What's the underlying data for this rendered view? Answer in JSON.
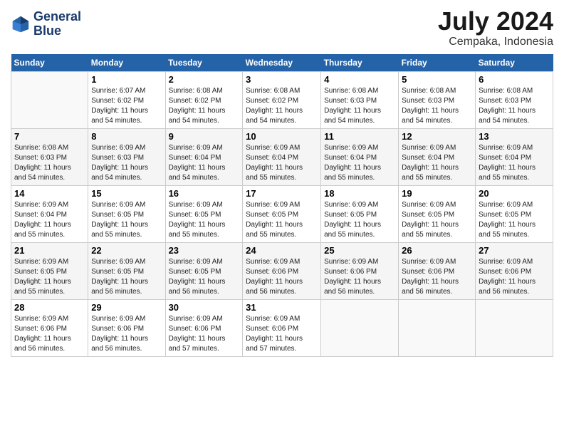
{
  "header": {
    "logo_line1": "General",
    "logo_line2": "Blue",
    "month": "July 2024",
    "location": "Cempaka, Indonesia"
  },
  "days_of_week": [
    "Sunday",
    "Monday",
    "Tuesday",
    "Wednesday",
    "Thursday",
    "Friday",
    "Saturday"
  ],
  "weeks": [
    [
      {
        "day": "",
        "info": ""
      },
      {
        "day": "1",
        "info": "Sunrise: 6:07 AM\nSunset: 6:02 PM\nDaylight: 11 hours\nand 54 minutes."
      },
      {
        "day": "2",
        "info": "Sunrise: 6:08 AM\nSunset: 6:02 PM\nDaylight: 11 hours\nand 54 minutes."
      },
      {
        "day": "3",
        "info": "Sunrise: 6:08 AM\nSunset: 6:02 PM\nDaylight: 11 hours\nand 54 minutes."
      },
      {
        "day": "4",
        "info": "Sunrise: 6:08 AM\nSunset: 6:03 PM\nDaylight: 11 hours\nand 54 minutes."
      },
      {
        "day": "5",
        "info": "Sunrise: 6:08 AM\nSunset: 6:03 PM\nDaylight: 11 hours\nand 54 minutes."
      },
      {
        "day": "6",
        "info": "Sunrise: 6:08 AM\nSunset: 6:03 PM\nDaylight: 11 hours\nand 54 minutes."
      }
    ],
    [
      {
        "day": "7",
        "info": "Sunrise: 6:08 AM\nSunset: 6:03 PM\nDaylight: 11 hours\nand 54 minutes."
      },
      {
        "day": "8",
        "info": "Sunrise: 6:09 AM\nSunset: 6:03 PM\nDaylight: 11 hours\nand 54 minutes."
      },
      {
        "day": "9",
        "info": "Sunrise: 6:09 AM\nSunset: 6:04 PM\nDaylight: 11 hours\nand 54 minutes."
      },
      {
        "day": "10",
        "info": "Sunrise: 6:09 AM\nSunset: 6:04 PM\nDaylight: 11 hours\nand 55 minutes."
      },
      {
        "day": "11",
        "info": "Sunrise: 6:09 AM\nSunset: 6:04 PM\nDaylight: 11 hours\nand 55 minutes."
      },
      {
        "day": "12",
        "info": "Sunrise: 6:09 AM\nSunset: 6:04 PM\nDaylight: 11 hours\nand 55 minutes."
      },
      {
        "day": "13",
        "info": "Sunrise: 6:09 AM\nSunset: 6:04 PM\nDaylight: 11 hours\nand 55 minutes."
      }
    ],
    [
      {
        "day": "14",
        "info": "Sunrise: 6:09 AM\nSunset: 6:04 PM\nDaylight: 11 hours\nand 55 minutes."
      },
      {
        "day": "15",
        "info": "Sunrise: 6:09 AM\nSunset: 6:05 PM\nDaylight: 11 hours\nand 55 minutes."
      },
      {
        "day": "16",
        "info": "Sunrise: 6:09 AM\nSunset: 6:05 PM\nDaylight: 11 hours\nand 55 minutes."
      },
      {
        "day": "17",
        "info": "Sunrise: 6:09 AM\nSunset: 6:05 PM\nDaylight: 11 hours\nand 55 minutes."
      },
      {
        "day": "18",
        "info": "Sunrise: 6:09 AM\nSunset: 6:05 PM\nDaylight: 11 hours\nand 55 minutes."
      },
      {
        "day": "19",
        "info": "Sunrise: 6:09 AM\nSunset: 6:05 PM\nDaylight: 11 hours\nand 55 minutes."
      },
      {
        "day": "20",
        "info": "Sunrise: 6:09 AM\nSunset: 6:05 PM\nDaylight: 11 hours\nand 55 minutes."
      }
    ],
    [
      {
        "day": "21",
        "info": "Sunrise: 6:09 AM\nSunset: 6:05 PM\nDaylight: 11 hours\nand 55 minutes."
      },
      {
        "day": "22",
        "info": "Sunrise: 6:09 AM\nSunset: 6:05 PM\nDaylight: 11 hours\nand 56 minutes."
      },
      {
        "day": "23",
        "info": "Sunrise: 6:09 AM\nSunset: 6:05 PM\nDaylight: 11 hours\nand 56 minutes."
      },
      {
        "day": "24",
        "info": "Sunrise: 6:09 AM\nSunset: 6:06 PM\nDaylight: 11 hours\nand 56 minutes."
      },
      {
        "day": "25",
        "info": "Sunrise: 6:09 AM\nSunset: 6:06 PM\nDaylight: 11 hours\nand 56 minutes."
      },
      {
        "day": "26",
        "info": "Sunrise: 6:09 AM\nSunset: 6:06 PM\nDaylight: 11 hours\nand 56 minutes."
      },
      {
        "day": "27",
        "info": "Sunrise: 6:09 AM\nSunset: 6:06 PM\nDaylight: 11 hours\nand 56 minutes."
      }
    ],
    [
      {
        "day": "28",
        "info": "Sunrise: 6:09 AM\nSunset: 6:06 PM\nDaylight: 11 hours\nand 56 minutes."
      },
      {
        "day": "29",
        "info": "Sunrise: 6:09 AM\nSunset: 6:06 PM\nDaylight: 11 hours\nand 56 minutes."
      },
      {
        "day": "30",
        "info": "Sunrise: 6:09 AM\nSunset: 6:06 PM\nDaylight: 11 hours\nand 57 minutes."
      },
      {
        "day": "31",
        "info": "Sunrise: 6:09 AM\nSunset: 6:06 PM\nDaylight: 11 hours\nand 57 minutes."
      },
      {
        "day": "",
        "info": ""
      },
      {
        "day": "",
        "info": ""
      },
      {
        "day": "",
        "info": ""
      }
    ]
  ]
}
